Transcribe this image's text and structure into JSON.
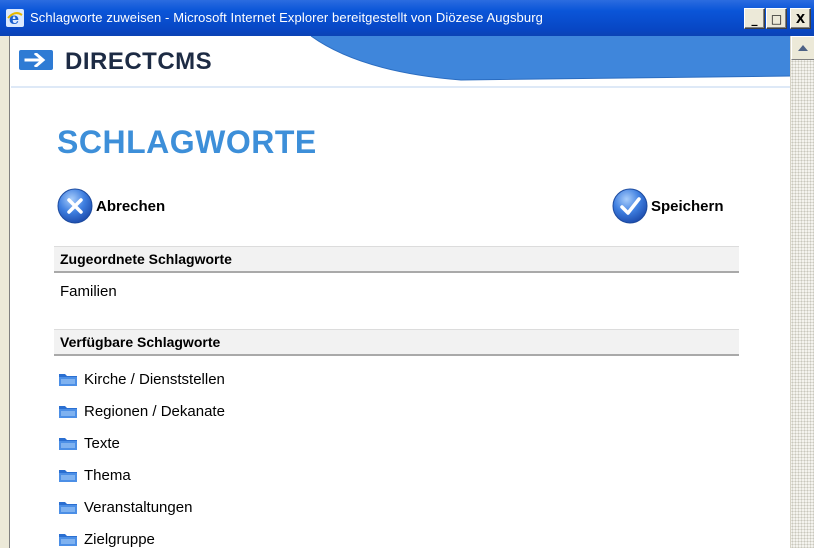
{
  "window": {
    "title": "Schlagworte zuweisen - Microsoft Internet Explorer bereitgestellt von Diözese Augsburg",
    "controls": {
      "minimize": "_",
      "maximize": "□",
      "close": "X"
    }
  },
  "brand": {
    "name": "DIRECTCMS",
    "icon": "arrow-right-icon",
    "accent": "#3d8fd9"
  },
  "page": {
    "title": "SCHLAGWORTE",
    "cancel_label": "Abrechen",
    "save_label": "Speichern"
  },
  "assigned": {
    "heading": "Zugeordnete Schlagworte",
    "items": [
      "Familien"
    ]
  },
  "available": {
    "heading": "Verfügbare Schlagworte",
    "items": [
      {
        "label": "Kirche / Dienststellen",
        "icon": "folder-icon"
      },
      {
        "label": "Regionen / Dekanate",
        "icon": "folder-icon"
      },
      {
        "label": "Texte",
        "icon": "folder-icon"
      },
      {
        "label": "Thema",
        "icon": "folder-icon"
      },
      {
        "label": "Veranstaltungen",
        "icon": "folder-icon"
      },
      {
        "label": "Zielgruppe",
        "icon": "folder-icon"
      }
    ]
  }
}
